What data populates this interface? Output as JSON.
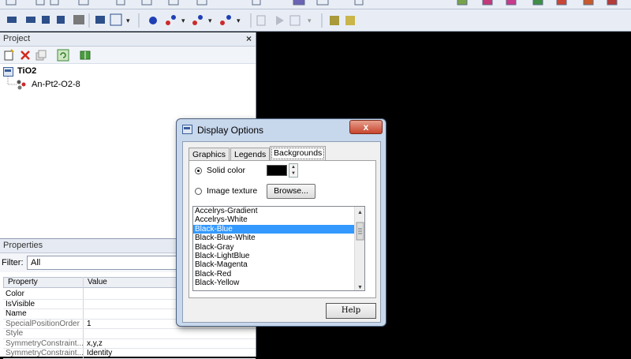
{
  "project": {
    "title": "Project",
    "close": "×",
    "root": "TiO2",
    "child": "An-Pt2-O2-8"
  },
  "properties": {
    "title": "Properties",
    "filter_label": "Filter:",
    "filter_value": "All",
    "columns": [
      "Property",
      "Value"
    ],
    "rows": [
      {
        "name": "Color",
        "value": ""
      },
      {
        "name": "IsVisible",
        "value": ""
      },
      {
        "name": "Name",
        "value": ""
      },
      {
        "name": "SpecialPositionOrder",
        "value": "1"
      },
      {
        "name": "Style",
        "value": ""
      },
      {
        "name": "SymmetryConstraint...",
        "value": "x,y,z"
      },
      {
        "name": "SymmetryConstraint...",
        "value": "Identity"
      }
    ]
  },
  "dialog": {
    "title": "Display Options",
    "close": "x",
    "tabs": [
      "Graphics",
      "Legends",
      "Backgrounds"
    ],
    "active_tab": "Backgrounds",
    "solid_color_label": "Solid color",
    "image_texture_label": "Image texture",
    "browse_label": "Browse...",
    "backgrounds": [
      "Accelrys-Gradient",
      "Accelrys-White",
      "Black-Blue",
      "Black-Blue-White",
      "Black-Gray",
      "Black-LightBlue",
      "Black-Magenta",
      "Black-Red",
      "Black-Yellow"
    ],
    "selected_background": "Black-Blue",
    "help_label": "Help",
    "solid_color_value": "#000000"
  }
}
